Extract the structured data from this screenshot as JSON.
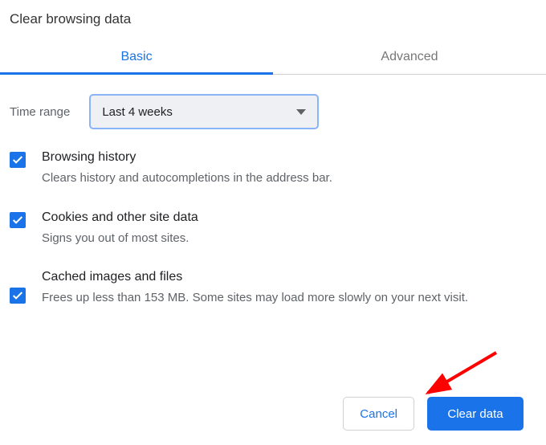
{
  "dialog": {
    "title": "Clear browsing data"
  },
  "tabs": {
    "basic": "Basic",
    "advanced": "Advanced"
  },
  "time": {
    "label": "Time range",
    "selected": "Last 4 weeks"
  },
  "options": [
    {
      "label": "Browsing history",
      "desc": "Clears history and autocompletions in the address bar.",
      "checked": true
    },
    {
      "label": "Cookies and other site data",
      "desc": "Signs you out of most sites.",
      "checked": true
    },
    {
      "label": "Cached images and files",
      "desc": "Frees up less than 153 MB. Some sites may load more slowly on your next visit.",
      "checked": true
    }
  ],
  "buttons": {
    "cancel": "Cancel",
    "clear": "Clear data"
  }
}
